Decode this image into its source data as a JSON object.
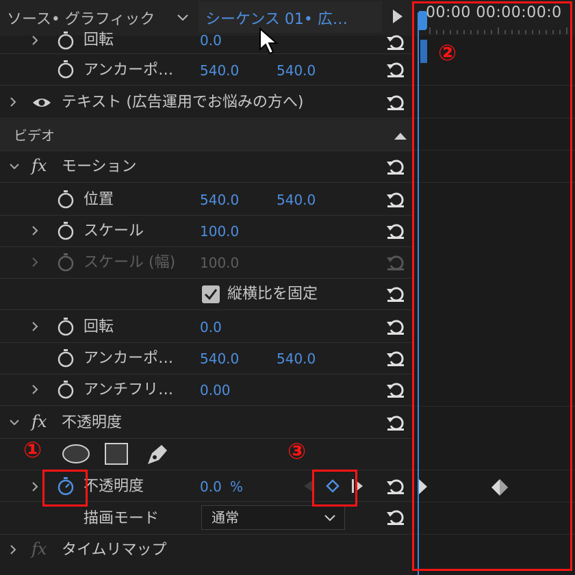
{
  "header": {
    "tab_source": "ソース• グラフィック",
    "tab_sequence": "シーケンス 01• 広…"
  },
  "timeline": {
    "timecode": "00:00 00:00:00:0"
  },
  "rows": {
    "rotate_top": {
      "label": "回転",
      "value": "0.0"
    },
    "anchor_top": {
      "label": "アンカーポ…",
      "x": "540.0",
      "y": "540.0"
    },
    "text_layer": {
      "label": "テキスト (広告運用でお悩みの方へ)"
    },
    "video_header": {
      "label": "ビデオ"
    },
    "motion": {
      "label": "モーション"
    },
    "position": {
      "label": "位置",
      "x": "540.0",
      "y": "540.0"
    },
    "scale": {
      "label": "スケール",
      "value": "100.0"
    },
    "scale_width": {
      "label": "スケール (幅)",
      "value": "100.0"
    },
    "uniform_scale": {
      "label": "縦横比を固定"
    },
    "rotation": {
      "label": "回転",
      "value": "0.0"
    },
    "anchor": {
      "label": "アンカーポ…",
      "x": "540.0",
      "y": "540.0"
    },
    "anti_flicker": {
      "label": "アンチフリ…",
      "value": "0.00"
    },
    "opacity_group": {
      "label": "不透明度"
    },
    "opacity": {
      "label": "不透明度",
      "value": "0.0",
      "unit": "%"
    },
    "blend_mode": {
      "label": "描画モード",
      "value": "通常"
    },
    "time_remap": {
      "label": "タイムリマップ"
    }
  },
  "annotations": {
    "one": "①",
    "two": "②",
    "three": "③"
  },
  "colors": {
    "accent": "#4d8fe0",
    "annotation": "#ff1414",
    "background": "#1e1e1e"
  }
}
